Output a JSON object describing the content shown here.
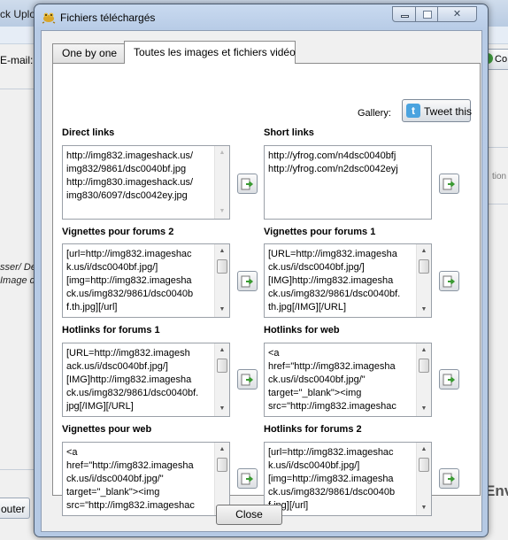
{
  "background": {
    "title_fragment": "ck Uplo",
    "email_label": "E-mail:",
    "right_button_label": "Co",
    "right_text_fragment": "tion d",
    "italic_line1": "sser/ De",
    "italic_line2": "Image d",
    "bottom_button_label": "outer",
    "env_fragment": "Env"
  },
  "dialog": {
    "title": "Fichiers téléchargés",
    "tabs": [
      {
        "label": "One by one",
        "selected": false
      },
      {
        "label": "Toutes les images et fichiers vidéo",
        "selected": true
      }
    ],
    "gallery_label": "Gallery:",
    "tweet_label": "Tweet this",
    "close_label": "Close",
    "sections": [
      {
        "label": "Direct links",
        "text": "http://img832.imageshack.us/\nimg832/9861/dsc0040bf.jpg\nhttp://img830.imageshack.us/\nimg830/6097/dsc0042ey.jpg"
      },
      {
        "label": "Short links",
        "text": "http://yfrog.com/n4dsc0040bfj\nhttp://yfrog.com/n2dsc0042eyj"
      },
      {
        "label": "Vignettes pour forums 2",
        "text": "[url=http://img832.imageshac\nk.us/i/dsc0040bf.jpg/]\n[img=http://img832.imagesha\nck.us/img832/9861/dsc0040b\nf.th.jpg][/url]"
      },
      {
        "label": "Vignettes pour forums 1",
        "text": "[URL=http://img832.imagesha\nck.us/i/dsc0040bf.jpg/]\n[IMG]http://img832.imagesha\nck.us/img832/9861/dsc0040bf.\nth.jpg[/IMG][/URL]"
      },
      {
        "label": "Hotlinks for forums 1",
        "text": "[URL=http://img832.imagesh\nack.us/i/dsc0040bf.jpg/]\n[IMG]http://img832.imagesha\nck.us/img832/9861/dsc0040bf.\njpg[/IMG][/URL]"
      },
      {
        "label": "Hotlinks for web",
        "text": "<a\nhref=\"http://img832.imagesha\nck.us/i/dsc0040bf.jpg/\"\ntarget=\"_blank\"><img\nsrc=\"http://img832.imageshac"
      },
      {
        "label": "Vignettes pour web",
        "text": "<a\nhref=\"http://img832.imagesha\nck.us/i/dsc0040bf.jpg/\"\ntarget=\"_blank\"><img\nsrc=\"http://img832.imageshac"
      },
      {
        "label": "Hotlinks for forums 2",
        "text": "[url=http://img832.imageshac\nk.us/i/dsc0040bf.jpg/]\n[img=http://img832.imagesha\nck.us/img832/9861/dsc0040b\nf.jpg][/url]"
      }
    ]
  },
  "colors": {
    "dialog_frame": "#b7cbe6",
    "client_bg": "#f0f0f0",
    "twitter_blue": "#4aa3df",
    "copy_arrow_green": "#3a9a32"
  },
  "icons": {
    "app": "frog-icon",
    "tweet": "twitter-bird-icon",
    "copy": "copy-to-clipboard-icon"
  }
}
